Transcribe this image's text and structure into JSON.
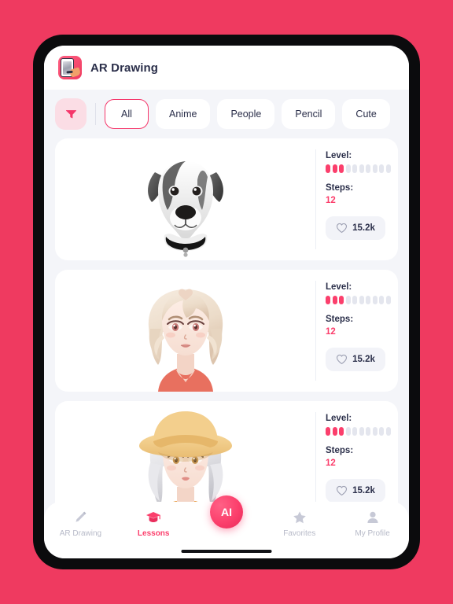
{
  "theme": {
    "background_pink": "#ef3a60",
    "accent_pink": "#fb3f6c",
    "text_dark": "#2b2f4a",
    "screen_bg": "#f4f5f9",
    "card_bg": "#ffffff",
    "muted_text": "#b7bac8"
  },
  "header": {
    "title": "AR Drawing",
    "icon": "app-logo-icon"
  },
  "filter_bar": {
    "filter_icon": "funnel-icon",
    "chips": [
      {
        "label": "All",
        "active": true
      },
      {
        "label": "Anime",
        "active": false
      },
      {
        "label": "People",
        "active": false
      },
      {
        "label": "Pencil",
        "active": false
      },
      {
        "label": "Cute",
        "active": false
      }
    ]
  },
  "cards": [
    {
      "artwork": "pencil-sketch-jack-russell-dog",
      "level_label": "Level:",
      "level_filled": 3,
      "level_total": 10,
      "steps_label": "Steps:",
      "steps_value": "12",
      "like_icon": "heart-outline-icon",
      "like_count": "15.2k"
    },
    {
      "artwork": "anime-girl-blonde-wavy-hair-red-top",
      "level_label": "Level:",
      "level_filled": 3,
      "level_total": 10,
      "steps_label": "Steps:",
      "steps_value": "12",
      "like_icon": "heart-outline-icon",
      "like_count": "15.2k"
    },
    {
      "artwork": "anime-girl-silver-hair-yellow-bucket-hat",
      "level_label": "Level:",
      "level_filled": 3,
      "level_total": 10,
      "steps_label": "Steps:",
      "steps_value": "12",
      "like_icon": "heart-outline-icon",
      "like_count": "15.2k"
    }
  ],
  "bottom_nav": {
    "items": [
      {
        "label": "AR Drawing",
        "icon": "pencil-icon",
        "active": false
      },
      {
        "label": "Lessons",
        "icon": "graduation-cap-icon",
        "active": true
      },
      {
        "label": "Favorites",
        "icon": "star-icon",
        "active": false
      },
      {
        "label": "My Profile",
        "icon": "person-icon",
        "active": false
      }
    ],
    "ai_button_label": "AI"
  }
}
